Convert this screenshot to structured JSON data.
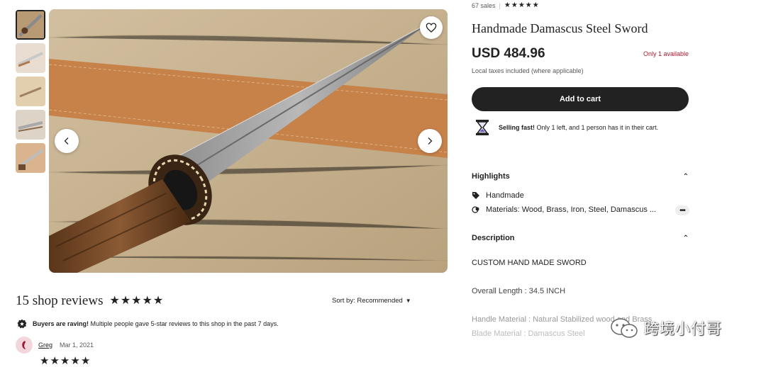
{
  "gallery": {
    "thumbnails": [
      "thumb-1",
      "thumb-2",
      "thumb-3",
      "thumb-4",
      "thumb-5"
    ],
    "active_index": 0,
    "fav_icon": "heart-icon",
    "prev_icon": "chevron-left-icon",
    "next_icon": "chevron-right-icon"
  },
  "reviews": {
    "count_label": "15 shop reviews",
    "rating": 5,
    "sort_label": "Sort by: Recommended",
    "raving_bold": "Buyers are raving!",
    "raving_text": " Multiple people gave 5-star reviews to this shop in the past 7 days.",
    "first_review": {
      "name": "Greg",
      "date": "Mar 1, 2021",
      "rating": 5
    }
  },
  "listing": {
    "sales": "67 sales",
    "rating": 5,
    "title": "Handmade Damascus Steel Sword",
    "price": "USD 484.96",
    "availability": "Only 1 available",
    "taxes": "Local taxes included (where applicable)",
    "cart_label": "Add to cart",
    "selling_fast_bold": "Selling fast!",
    "selling_fast_text": " Only 1 left, and 1 person has it in their cart.",
    "highlights": {
      "heading": "Highlights",
      "items": [
        {
          "icon": "tag-icon",
          "text": "Handmade"
        },
        {
          "icon": "materials-icon",
          "text": "Materials: Wood, Brass, Iron, Steel, Damascus ..."
        }
      ]
    },
    "description": {
      "heading": "Description",
      "lines": [
        "CUSTOM HAND MADE SWORD",
        "Overall Length : 34.5 INCH",
        "Handle Material : Natural Stabilized wood and Brass",
        "Blade Material : Damascus Steel"
      ]
    }
  },
  "watermark": {
    "text": "跨境小付哥"
  },
  "colors": {
    "accent_red": "#a61a2e",
    "button_dark": "#222222"
  }
}
